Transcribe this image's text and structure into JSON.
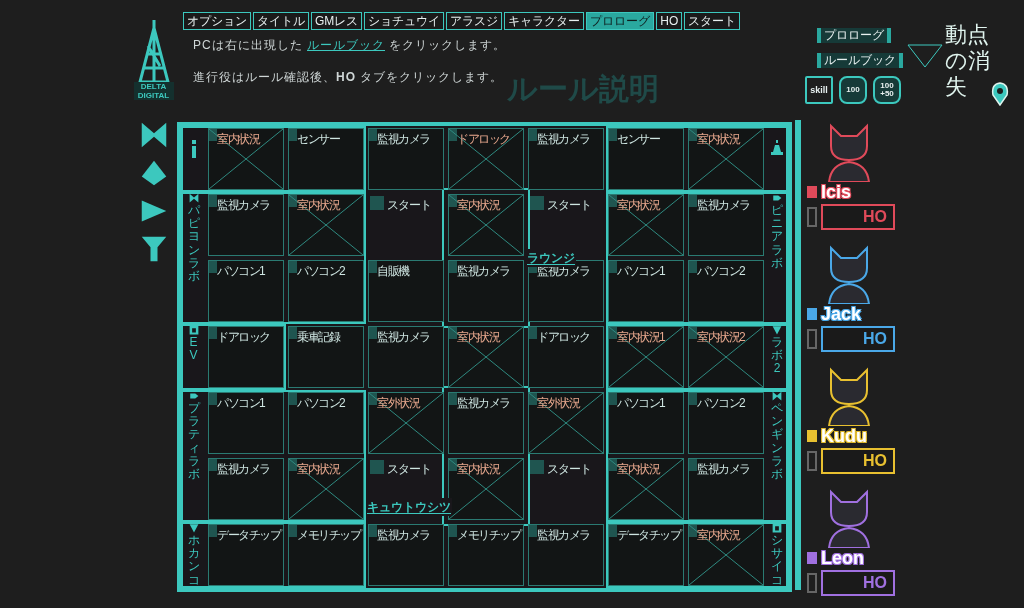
{
  "brand": {
    "logo_text": "DELTA DIGITAL"
  },
  "tabs": [
    {
      "label": "オプション",
      "selected": false
    },
    {
      "label": "タイトル",
      "selected": false
    },
    {
      "label": "GMレス",
      "selected": false
    },
    {
      "label": "ショチュウイ",
      "selected": false
    },
    {
      "label": "アラスジ",
      "selected": false
    },
    {
      "label": "キャラクター",
      "selected": false
    },
    {
      "label": "プロローグ",
      "selected": true
    },
    {
      "label": "HO",
      "selected": false
    },
    {
      "label": "スタート",
      "selected": false
    }
  ],
  "instructions": {
    "line1": {
      "before": "PCは右に出現した ",
      "link": "ルールブック",
      "after": " をクリックします。"
    },
    "line2": "進行役はルール確認後、**HO** タブをクリックします。"
  },
  "page_title": "ルール説明",
  "side_buttons": [
    "プロローグ",
    "ルールブック"
  ],
  "tool_buttons": [
    {
      "kind": "skill",
      "label": "skill"
    },
    {
      "kind": "hex",
      "label": "100"
    },
    {
      "kind": "hex",
      "label": "100\n+50"
    }
  ],
  "game_title": "動点の消失",
  "board": {
    "left_rooms": [
      {
        "label": "パピヨンラボ"
      },
      {
        "label": "EV"
      },
      {
        "label": "プラティラボ"
      },
      {
        "label": "ホカンコ"
      }
    ],
    "right_rooms": [
      {
        "label": "ピニアラボ"
      },
      {
        "label": "ラボ2"
      },
      {
        "label": "ペンギンラボ"
      },
      {
        "label": "シサイコ"
      }
    ],
    "area_labels": [
      "ラウンジ",
      "キュウトウシツ"
    ],
    "rows": [
      [
        {
          "kind": "panel",
          "title": "室内状況",
          "crossed": true
        },
        {
          "kind": "panel",
          "title": "センサー",
          "crossed": false
        },
        {
          "kind": "panel",
          "title": "監視カメラ",
          "crossed": false
        },
        {
          "kind": "panel",
          "title": "ドアロック",
          "crossed": true
        },
        {
          "kind": "panel",
          "title": "監視カメラ",
          "crossed": false
        },
        {
          "kind": "panel",
          "title": "センサー",
          "crossed": false
        },
        {
          "kind": "panel",
          "title": "室内状況",
          "crossed": true
        }
      ],
      [
        {
          "kind": "panel",
          "title": "監視カメラ",
          "crossed": false
        },
        {
          "kind": "panel",
          "title": "室内状況",
          "crossed": true
        },
        {
          "kind": "start",
          "title": "スタート",
          "crossed": false
        },
        {
          "kind": "panel",
          "title": "室内状況",
          "crossed": true
        },
        {
          "kind": "start",
          "title": "スタート",
          "crossed": false
        },
        {
          "kind": "panel",
          "title": "室内状況",
          "crossed": true
        },
        {
          "kind": "panel",
          "title": "監視カメラ",
          "crossed": false
        }
      ],
      [
        {
          "kind": "panel",
          "title": "パソコン1",
          "crossed": false
        },
        {
          "kind": "panel",
          "title": "パソコン2",
          "crossed": false
        },
        {
          "kind": "panel",
          "title": "自販機",
          "crossed": false
        },
        {
          "kind": "panel",
          "title": "監視カメラ",
          "crossed": false
        },
        {
          "kind": "panel",
          "title": "監視カメラ",
          "crossed": false
        },
        {
          "kind": "panel",
          "title": "パソコン1",
          "crossed": false
        },
        {
          "kind": "panel",
          "title": "パソコン2",
          "crossed": false
        }
      ],
      [
        {
          "kind": "panel",
          "title": "ドアロック",
          "crossed": false
        },
        {
          "kind": "panel",
          "title": "乗車記録",
          "crossed": false
        },
        {
          "kind": "panel",
          "title": "監視カメラ",
          "crossed": false
        },
        {
          "kind": "panel",
          "title": "室内状況",
          "crossed": true
        },
        {
          "kind": "panel",
          "title": "ドアロック",
          "crossed": false
        },
        {
          "kind": "panel",
          "title": "室内状況1",
          "crossed": true
        },
        {
          "kind": "panel",
          "title": "室内状況2",
          "crossed": true
        }
      ],
      [
        {
          "kind": "panel",
          "title": "パソコン1",
          "crossed": false
        },
        {
          "kind": "panel",
          "title": "パソコン2",
          "crossed": false
        },
        {
          "kind": "panel",
          "title": "室外状況",
          "crossed": true
        },
        {
          "kind": "panel",
          "title": "監視カメラ",
          "crossed": false
        },
        {
          "kind": "panel",
          "title": "室外状況",
          "crossed": true
        },
        {
          "kind": "panel",
          "title": "パソコン1",
          "crossed": false
        },
        {
          "kind": "panel",
          "title": "パソコン2",
          "crossed": false
        }
      ],
      [
        {
          "kind": "panel",
          "title": "監視カメラ",
          "crossed": false
        },
        {
          "kind": "panel",
          "title": "室内状況",
          "crossed": true
        },
        {
          "kind": "start",
          "title": "スタート",
          "crossed": false
        },
        {
          "kind": "panel",
          "title": "室内状況",
          "crossed": true
        },
        {
          "kind": "start",
          "title": "スタート",
          "crossed": false
        },
        {
          "kind": "panel",
          "title": "室内状況",
          "crossed": true
        },
        {
          "kind": "panel",
          "title": "監視カメラ",
          "crossed": false
        }
      ],
      [
        {
          "kind": "panel",
          "title": "データチップ",
          "crossed": false
        },
        {
          "kind": "panel",
          "title": "メモリチップ",
          "crossed": false
        },
        {
          "kind": "panel",
          "title": "監視カメラ",
          "crossed": false
        },
        {
          "kind": "panel",
          "title": "メモリチップ",
          "crossed": false
        },
        {
          "kind": "panel",
          "title": "監視カメラ",
          "crossed": false
        },
        {
          "kind": "panel",
          "title": "データチップ",
          "crossed": false
        },
        {
          "kind": "panel",
          "title": "室内状況",
          "crossed": true
        }
      ]
    ]
  },
  "characters": [
    {
      "name": "Icis",
      "color": "#e04a5a",
      "field": "HO"
    },
    {
      "name": "Jack",
      "color": "#4aa8e8",
      "field": "HO"
    },
    {
      "name": "Kudu",
      "color": "#e8c030",
      "field": "HO"
    },
    {
      "name": "Leon",
      "color": "#a070e0",
      "field": "HO"
    }
  ]
}
